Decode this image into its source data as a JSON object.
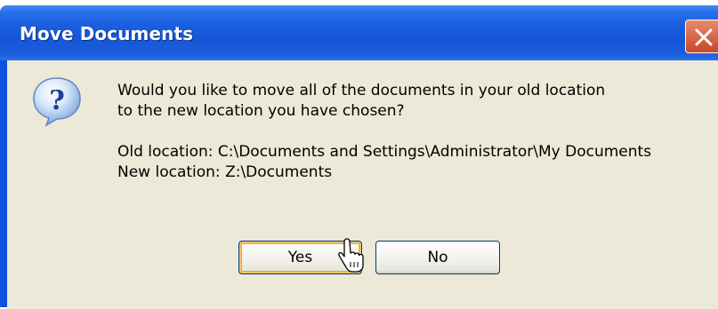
{
  "dialog": {
    "title": "Move Documents",
    "icon": "question-icon",
    "message_line1": "Would you like to move all of the documents in your old location",
    "message_line2": "to the new location you have chosen?",
    "old_location": "Old location: C:\\Documents and Settings\\Administrator\\My Documents",
    "new_location": "New location: Z:\\Documents",
    "yes_label": "Yes",
    "no_label": "No"
  },
  "colors": {
    "titlebar": "#0a52df",
    "client": "#ece9d8",
    "button_border": "#003c74",
    "default_focus": "#f7c06a"
  }
}
